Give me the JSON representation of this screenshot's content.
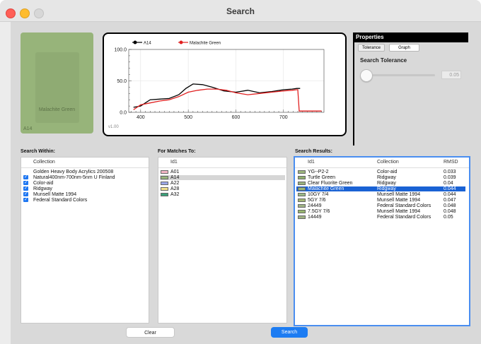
{
  "window": {
    "title": "Search"
  },
  "swatch": {
    "name": "Malachite Green",
    "code": "A14",
    "color": "#97b47a"
  },
  "graph": {
    "version": "v1.00",
    "chart_data": {
      "type": "line",
      "x_ticks": [
        "400",
        "500",
        "600",
        "700"
      ],
      "y_ticks": [
        "0.0",
        "50.0",
        "100.0"
      ],
      "xlim": [
        375,
        785
      ],
      "ylim": [
        0,
        100
      ],
      "series": [
        {
          "name": "A14",
          "color": "#000000",
          "x": [
            385,
            400,
            420,
            440,
            460,
            480,
            495,
            510,
            530,
            550,
            575,
            600,
            625,
            650,
            675,
            700,
            718,
            728,
            730,
            735
          ],
          "y": [
            8,
            10,
            20,
            21,
            22,
            28,
            38,
            45,
            44,
            40,
            34,
            32,
            35,
            31,
            33,
            36,
            37,
            38,
            38,
            38
          ]
        },
        {
          "name": "Malachite Green",
          "color": "#e02020",
          "x": [
            385,
            400,
            420,
            440,
            460,
            480,
            500,
            520,
            540,
            560,
            580,
            600,
            625,
            650,
            675,
            700,
            718,
            728,
            730,
            733,
            780
          ],
          "y": [
            4,
            12,
            15,
            18,
            20,
            25,
            32,
            35,
            37,
            37,
            35,
            31,
            28,
            30,
            32,
            34,
            35,
            36,
            36,
            2,
            2
          ]
        }
      ]
    }
  },
  "properties": {
    "header": "Properties",
    "tabs": [
      "Tolerance",
      "Graph"
    ],
    "tolerance_label": "Search Tolerance",
    "tolerance_value": "0.05",
    "slider_level": 0.0
  },
  "search_within": {
    "label": "Search Within:",
    "column": "Collection",
    "items": [
      {
        "label": "Golden Heavy Body Acrylics 200508",
        "checked": false
      },
      {
        "label": "Natural400nm-700nm-5nm U Finland",
        "checked": true
      },
      {
        "label": "Color-aid",
        "checked": true
      },
      {
        "label": "Ridgway",
        "checked": true
      },
      {
        "label": "Munsell Matte 1994",
        "checked": true
      },
      {
        "label": "Federal Standard Colors",
        "checked": true
      }
    ]
  },
  "matches": {
    "label": "For Matches To:",
    "column": "Id1",
    "items": [
      {
        "id": "A01",
        "color": "#f2b4c4"
      },
      {
        "id": "A14",
        "color": "#97b47a"
      },
      {
        "id": "A22",
        "color": "#9aa6e8"
      },
      {
        "id": "A28",
        "color": "#f2e08c"
      },
      {
        "id": "A32",
        "color": "#3aa079"
      }
    ]
  },
  "results": {
    "label": "Search Results:",
    "columns": [
      "Id1",
      "Collection",
      "RMSD"
    ],
    "rows": [
      {
        "id": "YG--P2-2",
        "collection": "Color-aid",
        "rmsd": "0.033",
        "color": "#9cb57d"
      },
      {
        "id": "Turtle Green",
        "collection": "Ridgway",
        "rmsd": "0.039",
        "color": "#8fae6e"
      },
      {
        "id": "Clear Fluorite Green",
        "collection": "Ridgway",
        "rmsd": "0.04",
        "color": "#99b17c"
      },
      {
        "id": "Malachite Green",
        "collection": "Ridgway",
        "rmsd": "0.044",
        "color": "#97b47a"
      },
      {
        "id": "10GY 7/4",
        "collection": "Munsell Matte 1994",
        "rmsd": "0.044",
        "color": "#9bb886"
      },
      {
        "id": "5GY 7/6",
        "collection": "Munsell Matte 1994",
        "rmsd": "0.047",
        "color": "#a2b673"
      },
      {
        "id": "24449",
        "collection": "Federal Standard Colors",
        "rmsd": "0.048",
        "color": "#a0b485"
      },
      {
        "id": "7.5GY 7/6",
        "collection": "Munsell Matte 1994",
        "rmsd": "0.048",
        "color": "#97b66f"
      },
      {
        "id": "14449",
        "collection": "Federal Standard Colors",
        "rmsd": "0.05",
        "color": "#9fb283"
      }
    ],
    "selected_index": 3
  },
  "buttons": {
    "clear": "Clear",
    "search": "Search"
  },
  "colors": {
    "accent": "#1d7cf2",
    "selection": "#1a62d4"
  }
}
